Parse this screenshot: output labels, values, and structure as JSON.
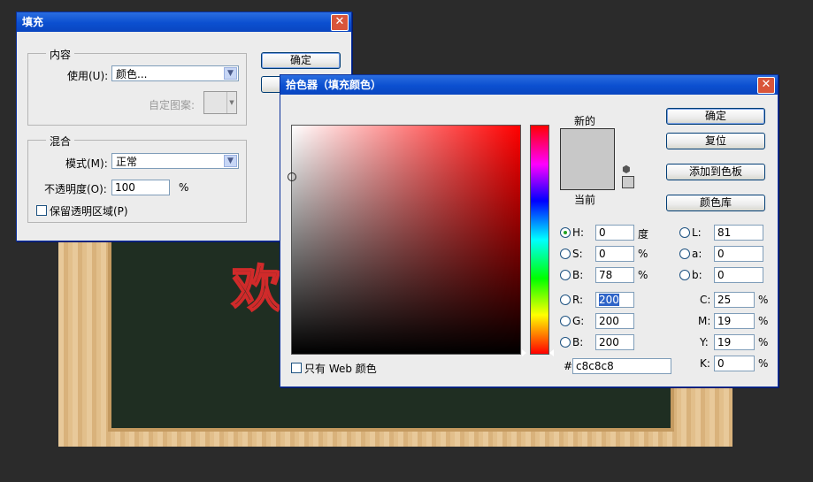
{
  "background_window": {
    "board_text": "欢"
  },
  "fill_dialog": {
    "title": "填充",
    "content_group": {
      "label": "内容",
      "use_label": "使用(U):",
      "use_value": "颜色...",
      "custom_pattern_label": "自定图案:"
    },
    "blend_group": {
      "label": "混合",
      "mode_label": "模式(M):",
      "mode_value": "正常",
      "opacity_label": "不透明度(O):",
      "opacity_value": "100",
      "opacity_unit": "%",
      "preserve_label": "保留透明区域(P)",
      "preserve_checked": false
    },
    "ok_label": "确定"
  },
  "color_picker": {
    "title": "拾色器（填充颜色）",
    "new_label": "新的",
    "current_label": "当前",
    "new_color": "#c8c8c8",
    "current_color": "#c8c8c8",
    "ok_label": "确定",
    "reset_label": "复位",
    "add_swatch_label": "添加到色板",
    "library_label": "颜色库",
    "web_only_label": "只有 Web 颜色",
    "web_only_checked": false,
    "fields": {
      "H": {
        "label": "H:",
        "value": "0",
        "unit": "度"
      },
      "S": {
        "label": "S:",
        "value": "0",
        "unit": "%"
      },
      "Bv": {
        "label": "B:",
        "value": "78",
        "unit": "%"
      },
      "R": {
        "label": "R:",
        "value": "200"
      },
      "G": {
        "label": "G:",
        "value": "200"
      },
      "Bc": {
        "label": "B:",
        "value": "200"
      },
      "L": {
        "label": "L:",
        "value": "81"
      },
      "a": {
        "label": "a:",
        "value": "0"
      },
      "b": {
        "label": "b:",
        "value": "0"
      },
      "C": {
        "label": "C:",
        "value": "25",
        "unit": "%"
      },
      "M": {
        "label": "M:",
        "value": "19",
        "unit": "%"
      },
      "Y": {
        "label": "Y:",
        "value": "19",
        "unit": "%"
      },
      "K": {
        "label": "K:",
        "value": "0",
        "unit": "%"
      },
      "hex_label": "#",
      "hex_value": "c8c8c8"
    }
  }
}
